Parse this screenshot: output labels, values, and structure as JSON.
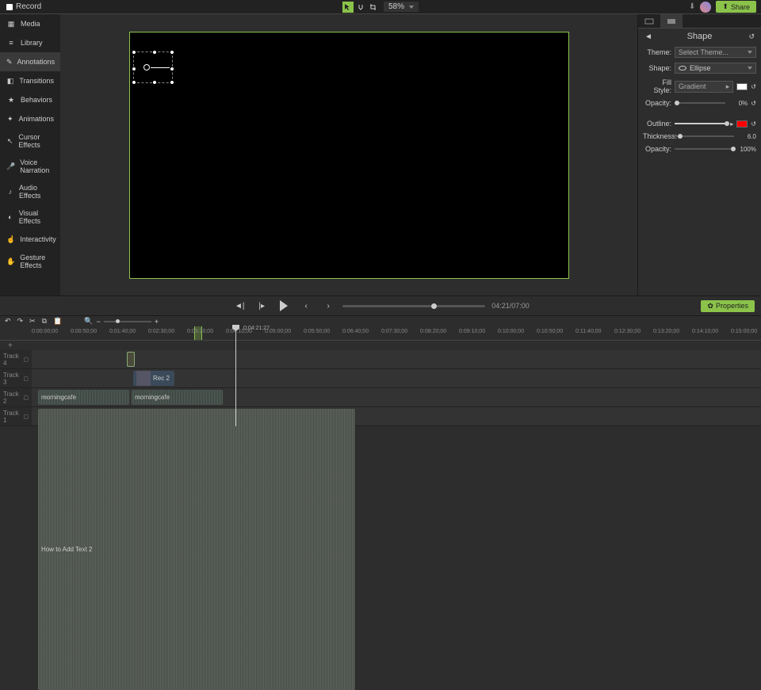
{
  "topbar": {
    "record": "Record",
    "zoom": "58%",
    "share": "Share"
  },
  "sidebar": {
    "items": [
      {
        "label": "Media"
      },
      {
        "label": "Library"
      },
      {
        "label": "Annotations"
      },
      {
        "label": "Transitions"
      },
      {
        "label": "Behaviors"
      },
      {
        "label": "Animations"
      },
      {
        "label": "Cursor Effects"
      },
      {
        "label": "Voice Narration"
      },
      {
        "label": "Audio Effects"
      },
      {
        "label": "Visual Effects"
      },
      {
        "label": "Interactivity"
      },
      {
        "label": "Gesture Effects"
      }
    ],
    "active": 2
  },
  "properties": {
    "title": "Shape",
    "theme_label": "Theme:",
    "theme_value": "Select Theme...",
    "shape_label": "Shape:",
    "shape_value": "Ellipse",
    "fill_label": "Fill Style:",
    "fill_value": "Gradient",
    "opacity_label": "Opacity:",
    "opacity_fill": "0%",
    "outline_label": "Outline:",
    "thickness_label": "Thickness:",
    "thickness_value": "6.0",
    "opacity_outline": "100%",
    "fill_swatch": "#ffffff",
    "outline_swatch": "#ff0000"
  },
  "playback": {
    "time": "04:21/07:00",
    "props_btn": "Properties"
  },
  "timeline": {
    "playhead_time": "0:04:21;27",
    "marks": [
      "0:00:00;00",
      "0:00:50;00",
      "0:01:40;00",
      "0:02:30;00",
      "0:03:20;00",
      "0:04:10;00",
      "0:05:00;00",
      "0:05:50;00",
      "0:06:40;00",
      "0:07:30;00",
      "0:08:20;00",
      "0:09:10;00",
      "0:10:00;00",
      "0:10:50;00",
      "0:11:40;00",
      "0:12:30;00",
      "0:13:20;00",
      "0:14:10;00",
      "0:15:00;00"
    ],
    "tracks": [
      {
        "name": "Track 4"
      },
      {
        "name": "Track 3"
      },
      {
        "name": "Track 2"
      },
      {
        "name": "Track 1"
      }
    ],
    "clips": {
      "rec": "Rec 2",
      "audio1": "morningcafe",
      "audio2": "morningcafe",
      "main": "How to Add Text 2"
    }
  }
}
